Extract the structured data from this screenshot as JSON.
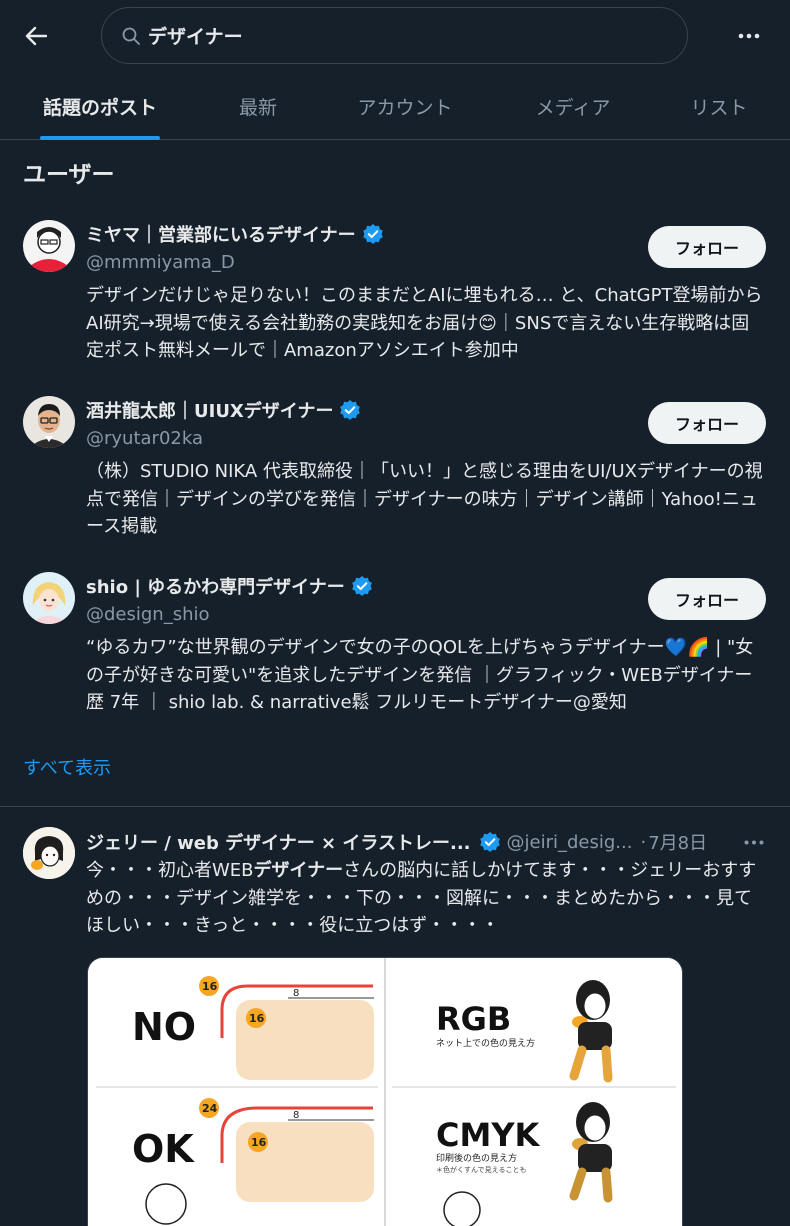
{
  "search": {
    "query": "デザイナー"
  },
  "tabs": [
    {
      "label": "話題のポスト"
    },
    {
      "label": "最新"
    },
    {
      "label": "アカウント"
    },
    {
      "label": "メディア"
    },
    {
      "label": "リスト"
    }
  ],
  "section_title": "ユーザー",
  "users": [
    {
      "name": "ミヤマ｜営業部にいるデザイナー",
      "handle": "@mmmiyama_D",
      "bio": "デザインだけじゃ足りない！このままだとAIに埋もれる… と、ChatGPT登場前からAI研究→現場で使える会社勤務の実践知をお届け😊｜SNSで言えない生存戦略は固定ポスト無料メールで｜Amazonアソシエイト参加中",
      "follow_label": "フォロー"
    },
    {
      "name": "酒井龍太郎｜UIUXデザイナー",
      "handle": "@ryutar02ka",
      "bio": "（株）STUDIO NIKA 代表取締役｜「いい！」と感じる理由をUI/UXデザイナーの視点で発信｜デザインの学びを発信｜デザイナーの味方｜デザイン講師｜Yahoo!ニュース掲載",
      "follow_label": "フォロー"
    },
    {
      "name": "shio | ゆるかわ専門デザイナー",
      "handle": "@design_shio",
      "bio": "“ゆるカワ”な世界観のデザインで女の子のQOLを上げちゃうデザイナー💙🌈 | \"女の子が好きな可愛い\"を追求したデザインを発信 ｜グラフィック・WEBデザイナー歴 7年 ｜ shio lab. & narrative鬆 フルリモートデザイナー@愛知",
      "follow_label": "フォロー"
    }
  ],
  "show_all": "すべて表示",
  "post": {
    "name": "ジェリー / web デザイナー × イラストレー...",
    "handle": "@jeiri_desig...",
    "dot": "·",
    "date": "7月8日",
    "text_before": "今・・・初心者WEB",
    "text_bold": "デザイナー",
    "text_after": "さんの脳内に話しかけてます・・・ジェリーおすすめの・・・デザイン雑学を・・・下の・・・図解に・・・まとめたから・・・見てほしい・・・きっと・・・・役に立つはず・・・・"
  },
  "media": {
    "no_label": "NO",
    "ok_label": "OK",
    "no_outer": "16",
    "no_inner": "16",
    "ok_outer": "24",
    "ok_inner": "16",
    "gap": "8",
    "rgb_label": "RGB",
    "rgb_caption": "ネット上での色の見え方",
    "cmyk_label": "CMYK",
    "cmyk_caption": "印刷後の色の見え方",
    "cmyk_note": "＊色がくすんで見えることも"
  },
  "colors": {
    "background": "#15202b",
    "accent": "#1d9bf0",
    "verified": "#1d9bf0",
    "text_secondary": "#8b98a5",
    "illustration_beige": "#f8dfc0",
    "illustration_orange": "#f5a623",
    "illustration_red": "#e8433a"
  },
  "icons": [
    "back-arrow-icon",
    "search-icon",
    "more-icon",
    "verified-badge-icon"
  ]
}
